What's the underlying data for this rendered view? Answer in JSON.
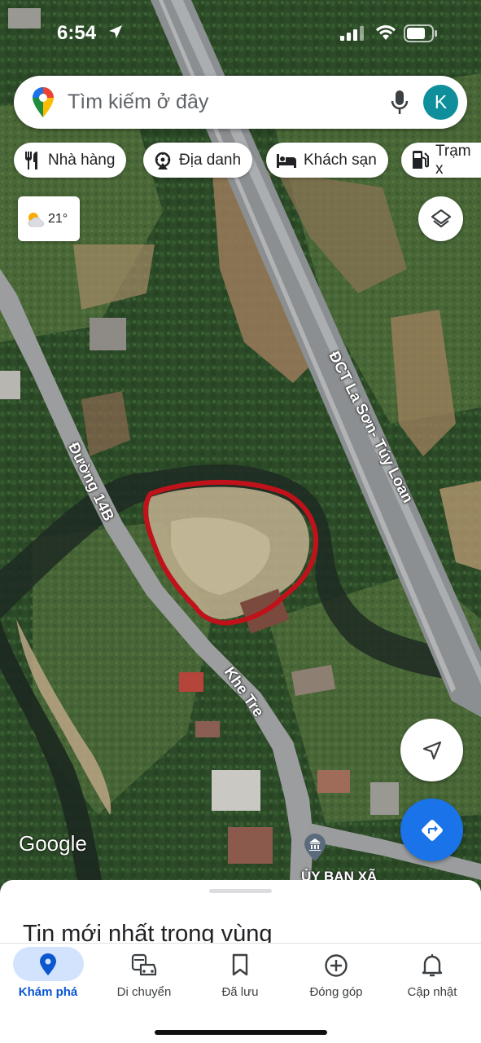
{
  "status_bar": {
    "time": "6:54"
  },
  "search": {
    "placeholder": "Tìm kiếm ở đây",
    "avatar_letter": "K"
  },
  "chips": [
    {
      "label": "Nhà hàng",
      "icon": "fork-knife-icon"
    },
    {
      "label": "Địa danh",
      "icon": "landmark-icon"
    },
    {
      "label": "Khách sạn",
      "icon": "bed-icon"
    },
    {
      "label": "Trạm x",
      "icon": "gas-station-icon"
    }
  ],
  "weather": {
    "temperature": "21°",
    "icon": "partly-sunny-icon"
  },
  "map": {
    "road_labels": {
      "expressway": "ĐCT La Sơn- Túy Loan",
      "road_14b": "Đường 14B",
      "khe_tre": "Khe Tre"
    },
    "poi_label": "ỦY BAN XÃ",
    "attribution": "Google",
    "highlight_color": "#c0121a"
  },
  "sheet": {
    "title": "Tin mới nhất trong vùng"
  },
  "nav": {
    "items": [
      {
        "label": "Khám phá",
        "icon": "location-pin-icon",
        "active": true
      },
      {
        "label": "Di chuyển",
        "icon": "commute-icon",
        "active": false
      },
      {
        "label": "Đã lưu",
        "icon": "bookmark-icon",
        "active": false
      },
      {
        "label": "Đóng góp",
        "icon": "add-circle-icon",
        "active": false
      },
      {
        "label": "Cập nhật",
        "icon": "bell-icon",
        "active": false
      }
    ]
  },
  "colors": {
    "accent": "#1a73e8",
    "nav_active": "#0b57d0",
    "avatar": "#0f8f9c"
  }
}
